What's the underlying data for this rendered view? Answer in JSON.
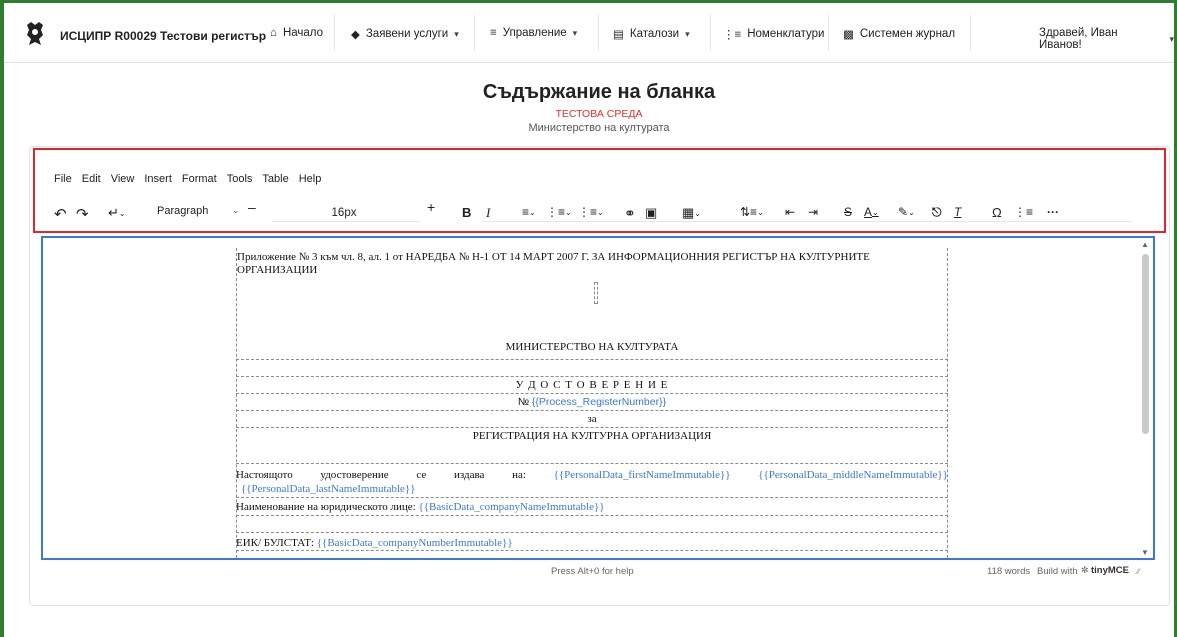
{
  "nav": {
    "brand": "ИСЦИПР R00029 Тестови регистър",
    "items": [
      {
        "icon": "home-icon",
        "label": "Начало",
        "caret": ""
      },
      {
        "icon": "graduation-cap-icon",
        "label": "Заявени услуги",
        "caret": "▾"
      },
      {
        "icon": "sliders-icon",
        "label": "Управление",
        "caret": "▾"
      },
      {
        "icon": "list-icon",
        "label": "Каталози",
        "caret": "▾"
      },
      {
        "icon": "list-ol-icon",
        "label": "Номенклатури",
        "caret": ""
      },
      {
        "icon": "table-icon",
        "label": "Системен журнал",
        "caret": ""
      }
    ],
    "user": "Здравей, Иван Иванов!"
  },
  "page": {
    "title": "Съдържание на бланка",
    "env": "ТЕСТОВА СРЕДА",
    "ministry": "Министерство на културата"
  },
  "editor": {
    "menu": [
      "File",
      "Edit",
      "View",
      "Insert",
      "Format",
      "Tools",
      "Table",
      "Help"
    ],
    "block_format": "Paragraph",
    "font_size": "16px",
    "status_left": "Press Alt+0 for help",
    "word_count": "118 words",
    "build_with": "Build with",
    "brand": "tinyMCE"
  },
  "doc": {
    "header": "Приложение № 3 към чл. 8, ал. 1 от НАРЕДБА № Н-1 ОТ 14 МАРТ 2007 Г. ЗА ИНФОРМАЦИОННИЯ РЕГИСТЪР НА КУЛТУРНИТЕ ОРГАНИЗАЦИИ",
    "ministry": "МИНИСТЕРСТВО НА КУЛТУРАТА",
    "cert": "У Д О С Т О В Е Р Е Н И Е",
    "no_prefix": "№",
    "no_ph": "{{Process_RegisterNumber}}",
    "za": "за",
    "reg": "РЕГИСТРАЦИЯ НА КУЛТУРНА ОРГАНИЗАЦИЯ",
    "issued_words": [
      "Настоящото",
      "удостоверение",
      "се",
      "издава",
      "на:"
    ],
    "ph_first": "{{PersonalData_firstNameImmutable}}",
    "ph_middle": "{{PersonalData_middleNameImmutable}}",
    "ph_last": "{{PersonalData_lastNameImmutable}}",
    "legal_label": "Наименование на юридическото лице:",
    "ph_company": "{{BasicData_companyNameImmutable}}",
    "eik_label": "ЕИК/ БУЛСТАТ:",
    "ph_eik": "{{BasicData_companyNumberImmutable}}"
  }
}
